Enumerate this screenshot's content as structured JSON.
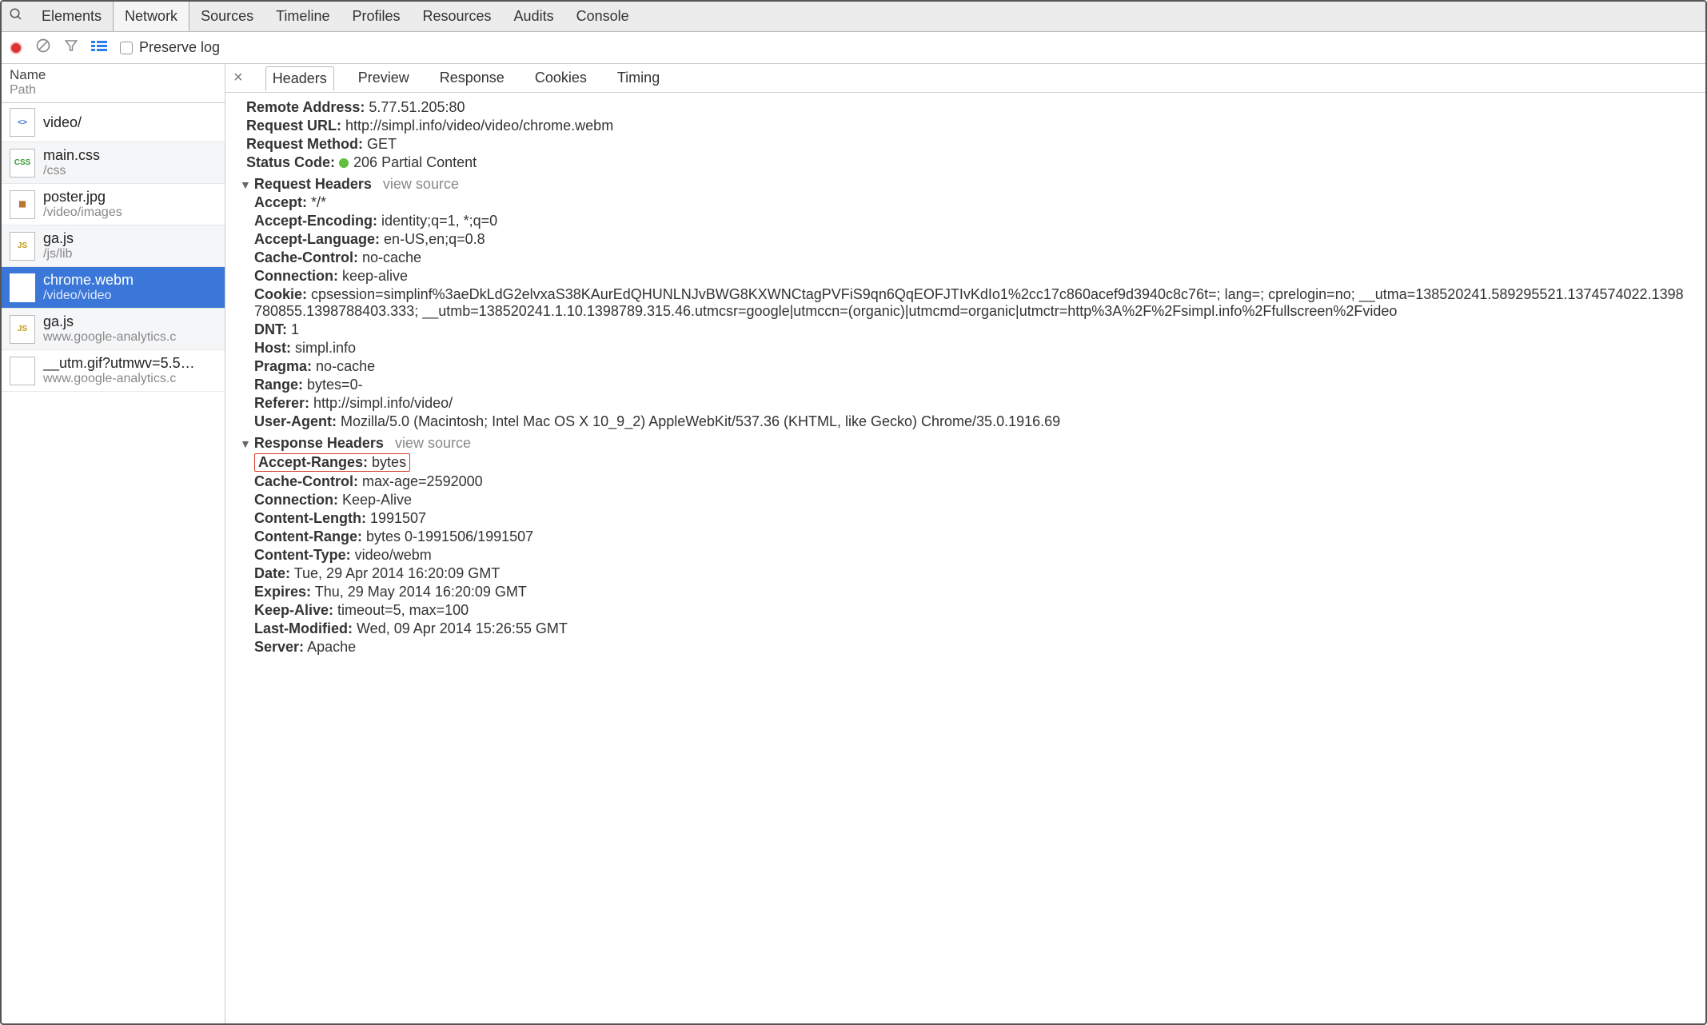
{
  "topTabs": {
    "items": [
      "Elements",
      "Network",
      "Sources",
      "Timeline",
      "Profiles",
      "Resources",
      "Audits",
      "Console"
    ],
    "active": "Network"
  },
  "toolbar": {
    "preserveLabel": "Preserve log"
  },
  "sidebar": {
    "headName": "Name",
    "headPath": "Path",
    "files": [
      {
        "name": "video/",
        "path": "",
        "icon": "html"
      },
      {
        "name": "main.css",
        "path": "/css",
        "icon": "css"
      },
      {
        "name": "poster.jpg",
        "path": "/video/images",
        "icon": "img"
      },
      {
        "name": "ga.js",
        "path": "/js/lib",
        "icon": "js"
      },
      {
        "name": "chrome.webm",
        "path": "/video/video",
        "icon": "blank",
        "selected": true
      },
      {
        "name": "ga.js",
        "path": "www.google-analytics.c",
        "icon": "js"
      },
      {
        "name": "__utm.gif?utmwv=5.5…",
        "path": "www.google-analytics.c",
        "icon": "blank"
      }
    ]
  },
  "detailTabs": {
    "items": [
      "Headers",
      "Preview",
      "Response",
      "Cookies",
      "Timing"
    ],
    "active": "Headers"
  },
  "general": {
    "remoteAddressLabel": "Remote Address:",
    "remoteAddress": "5.77.51.205:80",
    "requestUrlLabel": "Request URL:",
    "requestUrl": "http://simpl.info/video/video/chrome.webm",
    "requestMethodLabel": "Request Method:",
    "requestMethod": "GET",
    "statusCodeLabel": "Status Code:",
    "statusCode": "206 Partial Content"
  },
  "section": {
    "requestHeaders": "Request Headers",
    "responseHeaders": "Response Headers",
    "viewSource": "view source"
  },
  "requestHeaders": [
    {
      "k": "Accept:",
      "v": "*/*"
    },
    {
      "k": "Accept-Encoding:",
      "v": "identity;q=1, *;q=0"
    },
    {
      "k": "Accept-Language:",
      "v": "en-US,en;q=0.8"
    },
    {
      "k": "Cache-Control:",
      "v": "no-cache"
    },
    {
      "k": "Connection:",
      "v": "keep-alive"
    },
    {
      "k": "Cookie:",
      "v": "cpsession=simplinf%3aeDkLdG2elvxaS38KAurEdQHUNLNJvBWG8KXWNCtagPVFiS9qn6QqEOFJTIvKdIo1%2cc17c860acef9d3940c8c76t=; lang=; cprelogin=no; __utma=138520241.589295521.1374574022.1398780855.1398788403.333; __utmb=138520241.1.10.1398789.315.46.utmcsr=google|utmccn=(organic)|utmcmd=organic|utmctr=http%3A%2F%2Fsimpl.info%2Ffullscreen%2Fvideo",
      "wrap": true
    },
    {
      "k": "DNT:",
      "v": "1"
    },
    {
      "k": "Host:",
      "v": "simpl.info"
    },
    {
      "k": "Pragma:",
      "v": "no-cache"
    },
    {
      "k": "Range:",
      "v": "bytes=0-"
    },
    {
      "k": "Referer:",
      "v": "http://simpl.info/video/"
    },
    {
      "k": "User-Agent:",
      "v": "Mozilla/5.0 (Macintosh; Intel Mac OS X 10_9_2) AppleWebKit/537.36 (KHTML, like Gecko) Chrome/35.0.1916.69"
    }
  ],
  "responseHeaders": [
    {
      "k": "Accept-Ranges:",
      "v": "bytes",
      "hl": true
    },
    {
      "k": "Cache-Control:",
      "v": "max-age=2592000"
    },
    {
      "k": "Connection:",
      "v": "Keep-Alive"
    },
    {
      "k": "Content-Length:",
      "v": "1991507"
    },
    {
      "k": "Content-Range:",
      "v": "bytes 0-1991506/1991507"
    },
    {
      "k": "Content-Type:",
      "v": "video/webm"
    },
    {
      "k": "Date:",
      "v": "Tue, 29 Apr 2014 16:20:09 GMT"
    },
    {
      "k": "Expires:",
      "v": "Thu, 29 May 2014 16:20:09 GMT"
    },
    {
      "k": "Keep-Alive:",
      "v": "timeout=5, max=100"
    },
    {
      "k": "Last-Modified:",
      "v": "Wed, 09 Apr 2014 15:26:55 GMT"
    },
    {
      "k": "Server:",
      "v": "Apache"
    }
  ],
  "iconGlyphs": {
    "html": "<>",
    "css": "CSS",
    "img": "▦",
    "js": "JS",
    "blank": ""
  }
}
